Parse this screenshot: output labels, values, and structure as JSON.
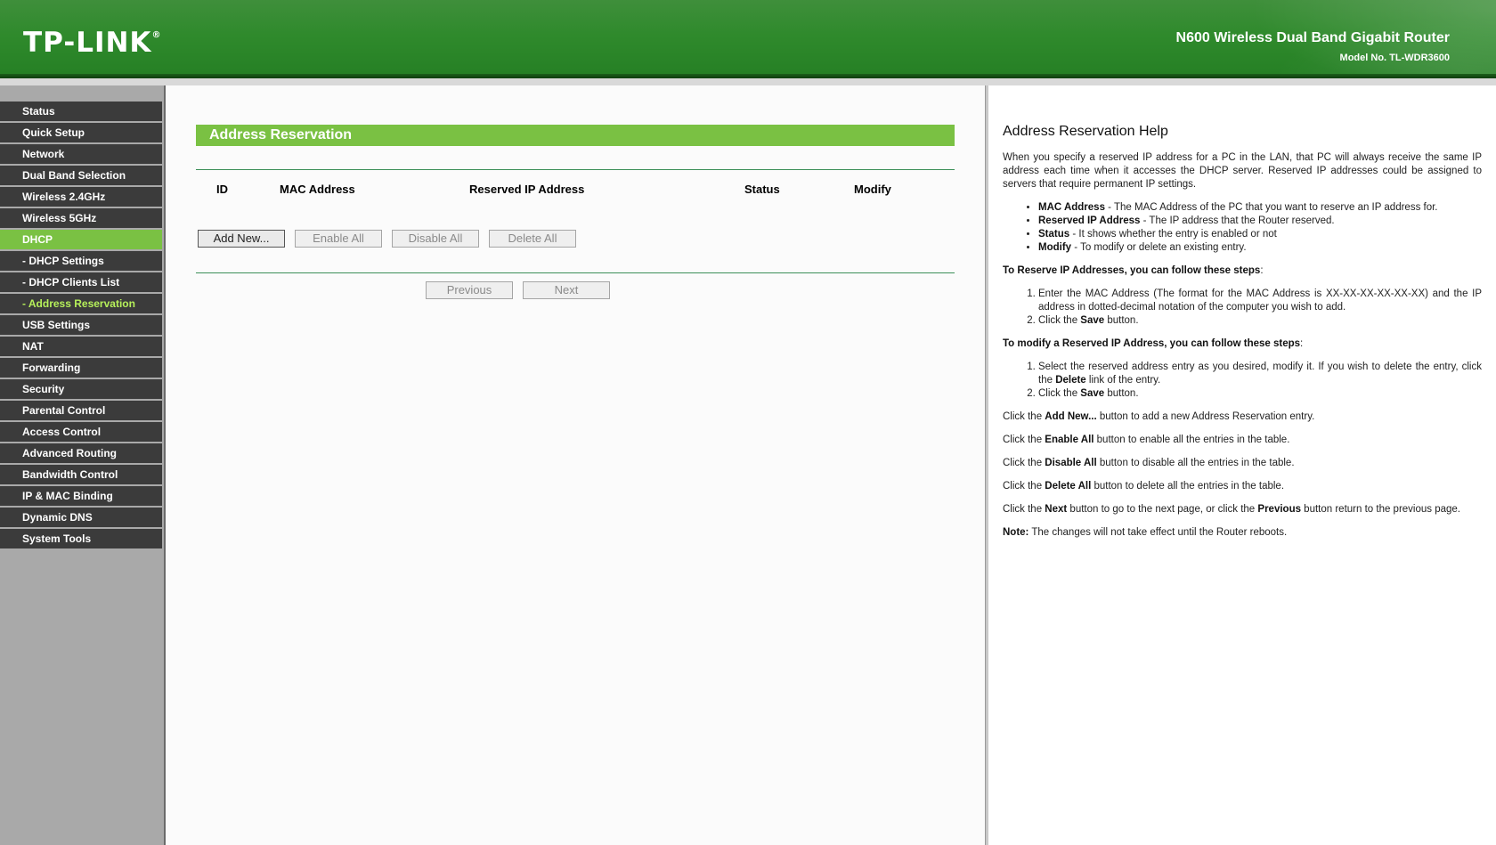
{
  "header": {
    "logo": "TP-LINK",
    "logo_mark": "®",
    "product_name": "N600 Wireless Dual Band Gigabit Router",
    "model_no": "Model No. TL-WDR3600"
  },
  "sidebar": {
    "items": [
      {
        "label": "Status"
      },
      {
        "label": "Quick Setup"
      },
      {
        "label": "Network"
      },
      {
        "label": "Dual Band Selection"
      },
      {
        "label": "Wireless 2.4GHz"
      },
      {
        "label": "Wireless 5GHz"
      },
      {
        "label": "DHCP"
      },
      {
        "label": "- DHCP Settings"
      },
      {
        "label": "- DHCP Clients List"
      },
      {
        "label": "- Address Reservation"
      },
      {
        "label": "USB Settings"
      },
      {
        "label": "NAT"
      },
      {
        "label": "Forwarding"
      },
      {
        "label": "Security"
      },
      {
        "label": "Parental Control"
      },
      {
        "label": "Access Control"
      },
      {
        "label": "Advanced Routing"
      },
      {
        "label": "Bandwidth Control"
      },
      {
        "label": "IP & MAC Binding"
      },
      {
        "label": "Dynamic DNS"
      },
      {
        "label": "System Tools"
      }
    ]
  },
  "main": {
    "title": "Address Reservation",
    "columns": [
      "ID",
      "MAC Address",
      "Reserved IP Address",
      "Status",
      "Modify"
    ],
    "buttons": {
      "add_new": "Add New...",
      "enable_all": "Enable All",
      "disable_all": "Disable All",
      "delete_all": "Delete All",
      "previous": "Previous",
      "next": "Next"
    }
  },
  "help": {
    "title": "Address Reservation Help",
    "intro": "When you specify a reserved IP address for a PC in the LAN, that PC will always receive the same IP address each time when it accesses the DHCP server. Reserved IP addresses could be assigned to servers that require permanent IP settings.",
    "fields": [
      {
        "term": "MAC Address",
        "desc": " - The MAC Address of the PC that you want to reserve an IP address for."
      },
      {
        "term": "Reserved IP Address",
        "desc": " - The IP address that the Router reserved."
      },
      {
        "term": "Status",
        "desc": " - It shows whether the entry is enabled or not"
      },
      {
        "term": "Modify",
        "desc": " - To modify or delete an existing entry."
      }
    ],
    "reserve_heading": "To Reserve IP Addresses, you can follow these steps",
    "reserve_step1": "Enter the MAC Address (The format for the MAC Address is XX-XX-XX-XX-XX-XX) and the IP address in dotted-decimal notation of the computer you wish to add.",
    "reserve_step2_pre": "Click the ",
    "reserve_step2_bold": "Save",
    "reserve_step2_post": " button.",
    "modify_heading": "To modify a Reserved IP Address, you can follow these steps",
    "modify_step1_pre": "Select the reserved address entry as you desired, modify it. If you wish to delete the entry, click the ",
    "modify_step1_bold": "Delete",
    "modify_step1_post": " link of the entry.",
    "modify_step2_pre": "Click the ",
    "modify_step2_bold": "Save",
    "modify_step2_post": " button.",
    "click_lines": [
      {
        "pre": "Click the ",
        "bold": "Add New...",
        "post": " button to add a new Address Reservation entry."
      },
      {
        "pre": "Click the ",
        "bold": "Enable All",
        "post": " button to enable all the entries in the table."
      },
      {
        "pre": "Click the ",
        "bold": "Disable All",
        "post": " button to disable all the entries in the table."
      },
      {
        "pre": "Click the ",
        "bold": "Delete All",
        "post": " button to delete all the entries in the table."
      }
    ],
    "next_line_pre": "Click the ",
    "next_line_bold1": "Next",
    "next_line_mid": " button to go to the next page, or click the ",
    "next_line_bold2": "Previous",
    "next_line_post": " button return to the previous page.",
    "note_label": "Note:",
    "note_text": " The changes will not take effect until the Router reboots."
  }
}
